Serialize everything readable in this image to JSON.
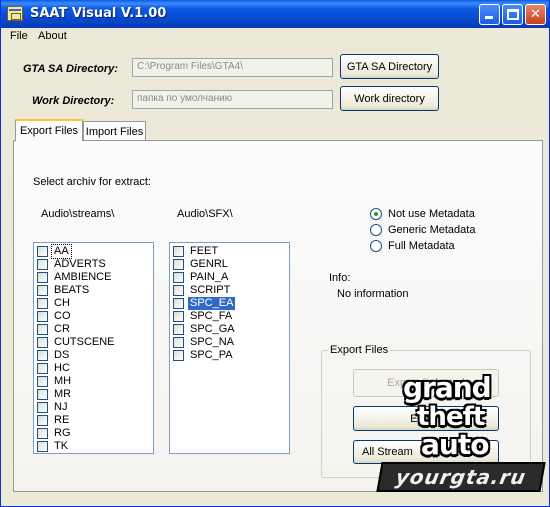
{
  "window": {
    "title": "SAAT Visual V.1.00",
    "minimize_glyph": "minimize",
    "maximize_glyph": "maximize",
    "close_glyph": "✕"
  },
  "menu": [
    "File",
    "About"
  ],
  "directories": {
    "gta_label": "GTA SA Directory:",
    "gta_value": "C:\\Program Files\\GTA4\\",
    "gta_button": "GTA SA Directory",
    "work_label": "Work Directory:",
    "work_value": "папка по умолчанию",
    "work_button": "Work directory"
  },
  "tabs": [
    "Export Files",
    "Import Files"
  ],
  "export": {
    "select_label": "Select archiv for extract:",
    "streams_label": "Audio\\streams\\",
    "sfx_label": "Audio\\SFX\\",
    "streams": [
      "AA",
      "ADVERTS",
      "AMBIENCE",
      "BEATS",
      "CH",
      "CO",
      "CR",
      "CUTSCENE",
      "DS",
      "HC",
      "MH",
      "MR",
      "NJ",
      "RE",
      "RG",
      "TK"
    ],
    "sfx": [
      "FEET",
      "GENRL",
      "PAIN_A",
      "SCRIPT",
      "SPC_EA",
      "SPC_FA",
      "SPC_GA",
      "SPC_NA",
      "SPC_PA"
    ],
    "sfx_selected": "SPC_EA",
    "metadata_options": [
      "Not use Metadata",
      "Generic Metadata",
      "Full Metadata"
    ],
    "metadata_selected": "Not use Metadata",
    "info_label": "Info:",
    "info_value": "No information",
    "group_title": "Export Files",
    "buttons": [
      "Export Selected",
      "Export",
      "All Stream"
    ]
  },
  "watermark": {
    "lines": [
      "grand",
      "theft",
      "auto"
    ],
    "site": "yourgta.ru"
  },
  "colors": {
    "titlebar": "#0a5ae8",
    "selection": "#316ac5",
    "face": "#ece9d8"
  }
}
